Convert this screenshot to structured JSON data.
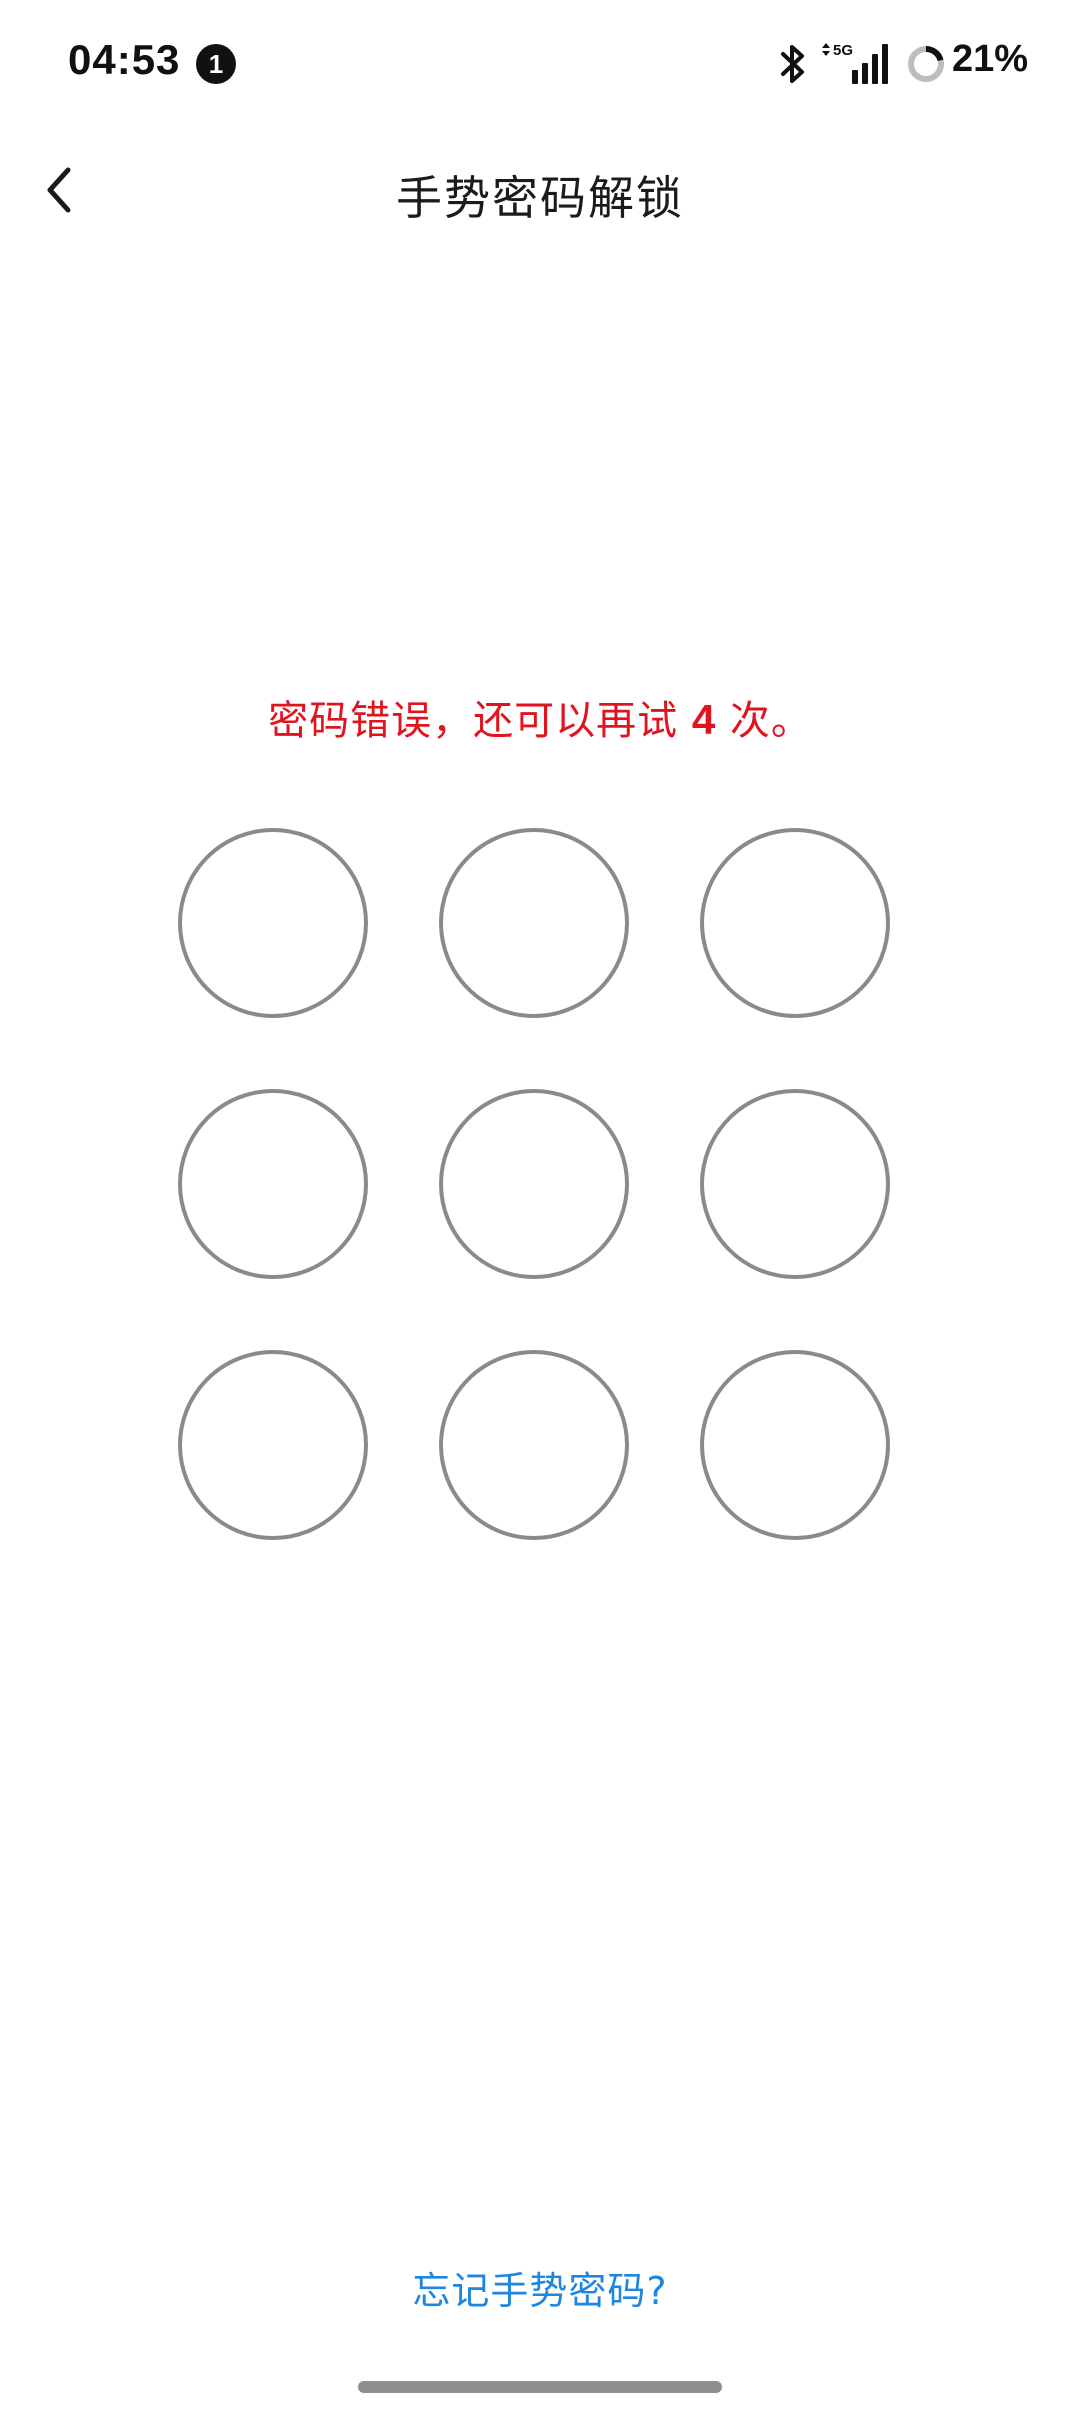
{
  "status_bar": {
    "time": "04:53",
    "notification_count": "1",
    "network": "5G",
    "battery_percent": "21%",
    "battery_level": 0.21
  },
  "header": {
    "title": "手势密码解锁",
    "back_icon": "chevron-left-icon"
  },
  "error": {
    "prefix": "密码错误，还可以再试 ",
    "remaining": "4",
    "suffix": " 次。",
    "color": "#e0141e"
  },
  "pattern": {
    "dots": [
      {
        "id": 1
      },
      {
        "id": 2
      },
      {
        "id": 3
      },
      {
        "id": 4
      },
      {
        "id": 5
      },
      {
        "id": 6
      },
      {
        "id": 7
      },
      {
        "id": 8
      },
      {
        "id": 9
      }
    ]
  },
  "footer": {
    "forgot_link": "忘记手势密码?",
    "link_color": "#1f86e0"
  }
}
